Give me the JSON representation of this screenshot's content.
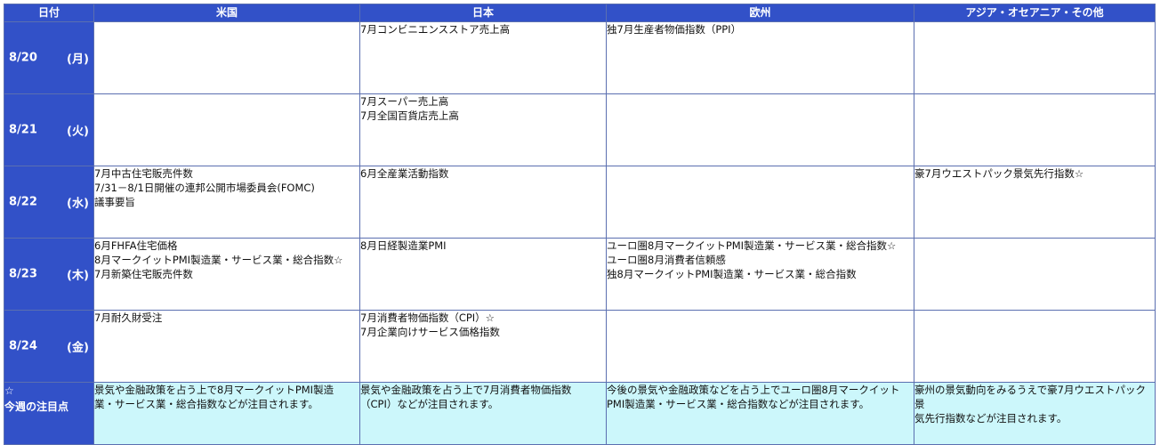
{
  "headers": {
    "date": "日付",
    "us": "米国",
    "jp": "日本",
    "eu": "欧州",
    "other": "アジア・オセアニア・その他"
  },
  "days": [
    {
      "date": "8/20",
      "weekday": "(月)",
      "us": [],
      "jp": [
        "7月コンビニエンスストア売上高"
      ],
      "eu": [
        "独7月生産者物価指数（PPI）"
      ],
      "other": []
    },
    {
      "date": "8/21",
      "weekday": "(火)",
      "us": [],
      "jp": [
        "7月スーパー売上高",
        "7月全国百貨店売上高"
      ],
      "eu": [],
      "other": []
    },
    {
      "date": "8/22",
      "weekday": "(水)",
      "us": [
        "7月中古住宅販売件数",
        "7/31－8/1日開催の連邦公開市場委員会(FOMC)",
        "議事要旨"
      ],
      "jp": [
        "6月全産業活動指数"
      ],
      "eu": [],
      "other": [
        "豪7月ウエストパック景気先行指数☆"
      ]
    },
    {
      "date": "8/23",
      "weekday": "(木)",
      "us": [
        "6月FHFA住宅価格",
        "8月マークイットPMI製造業・サービス業・総合指数☆",
        "7月新築住宅販売件数"
      ],
      "jp": [
        "8月日経製造業PMI"
      ],
      "eu": [
        "ユーロ圏8月マークイットPMI製造業・サービス業・総合指数☆",
        "ユーロ圏8月消費者信頼感",
        "独8月マークイットPMI製造業・サービス業・総合指数"
      ],
      "other": []
    },
    {
      "date": "8/24",
      "weekday": "(金)",
      "us": [
        "7月耐久財受注"
      ],
      "jp": [
        "7月消費者物価指数（CPI）☆",
        "7月企業向けサービス価格指数"
      ],
      "eu": [],
      "other": []
    }
  ],
  "notes": {
    "label_star": "☆",
    "label_text": "今週の注目点",
    "us": [
      "景気や金融政策を占う上で8月マークイットPMI製造",
      "業・サービス業・総合指数などが注目されます。"
    ],
    "jp": [
      "景気や金融政策を占う上で7月消費者物価指数",
      "（CPI）などが注目されます。"
    ],
    "eu": [
      "今後の景気や金融政策などを占う上でユーロ圏8月マークイット",
      "PMI製造業・サービス業・総合指数などが注目されます。"
    ],
    "other": [
      "豪州の景気動向をみるうえで豪7月ウエストパック景",
      "気先行指数などが注目されます。"
    ]
  }
}
